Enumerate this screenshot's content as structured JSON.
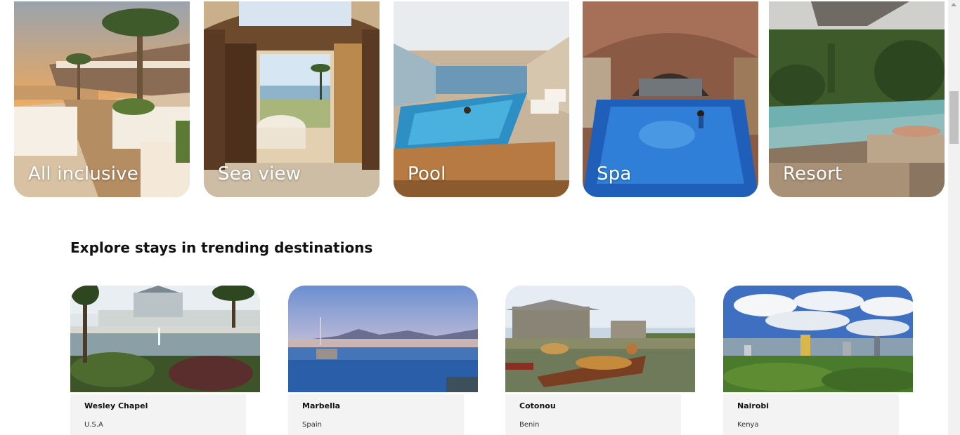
{
  "categories": [
    {
      "label": "All inclusive"
    },
    {
      "label": "Sea view"
    },
    {
      "label": "Pool"
    },
    {
      "label": "Spa"
    },
    {
      "label": "Resort"
    }
  ],
  "trending": {
    "title": "Explore stays in trending destinations",
    "destinations": [
      {
        "name": "Wesley Chapel",
        "country": "U.S.A"
      },
      {
        "name": "Marbella",
        "country": "Spain"
      },
      {
        "name": "Cotonou",
        "country": "Benin"
      },
      {
        "name": "Nairobi",
        "country": "Kenya"
      }
    ]
  }
}
